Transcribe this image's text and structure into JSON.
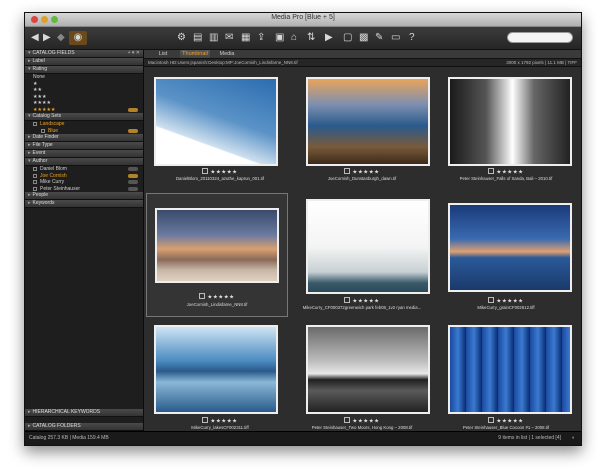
{
  "window": {
    "title": "Media Pro [Blue + 5]"
  },
  "toolbar": {
    "search_placeholder": ""
  },
  "sidebar": {
    "catalog_fields": "CATALOG FIELDS",
    "panels": {
      "label": "Label",
      "rating": "Rating",
      "catalog_sets": "Catalog Sets",
      "date_finder": "Date Finder",
      "file_type": "File Type",
      "event": "Event",
      "author": "Author",
      "people": "People",
      "keywords": "Keywords"
    },
    "rating_items": [
      "None",
      "★",
      "★★",
      "★★★",
      "★★★★",
      "★★★★★"
    ],
    "catalog_set_items": [
      "Landscape",
      "Blue"
    ],
    "author_items": [
      "Daniel Blom",
      "Joe Cornish",
      "Mike Curry",
      "Peter Steinhauser"
    ],
    "hierarchical_keywords": "HIERARCHICAL KEYWORDS",
    "catalog_folders": "CATALOG FOLDERS"
  },
  "tabs": [
    "List",
    "Thumbnail",
    "Media"
  ],
  "pathbar": {
    "path": "Macintosh HD:Users:jspanish:Desktop:MP:JoeCornish_Lindisfarne_NN8.tif",
    "info": "3000 x 1792 pixels  |  11.1 MB  |  TIFF"
  },
  "thumbnails": [
    {
      "caption": "DanielBlom_20110324_azuthe_kaprun_001.tif",
      "stars": "★★★★★"
    },
    {
      "caption": "JoeCornish_Dunstanburgh_dawn.tif",
      "stars": "★★★★★"
    },
    {
      "caption": "Peter Steinhauser_Falls of Sanda, Bali – 2010.tif",
      "stars": "★★★★★"
    },
    {
      "caption": "JoeCornish_Lindisfarne_NN8.tif",
      "stars": "★★★★★"
    },
    {
      "caption": "MikeCurry_CF000372greenwich park feb08_1v2 ryan media...",
      "stars": "★★★★★"
    },
    {
      "caption": "MikeCurry_grainCF002612.tiff",
      "stars": "★★★★★"
    },
    {
      "caption": "MikeCurry_lakesCF002311.tiff",
      "stars": "★★★★★"
    },
    {
      "caption": "Peter Steinhauser_Two Moors, Hong Kong – 2008.tif",
      "stars": "★★★★★"
    },
    {
      "caption": "Peter Steinhauser_Blue Cocoon #1 – 2008.tif",
      "stars": "★★★★★"
    }
  ],
  "status": {
    "left": "Catalog  257.3 KB  |  Media 159.4 MB",
    "right": "9 items in list  |  1 selected [4]"
  }
}
